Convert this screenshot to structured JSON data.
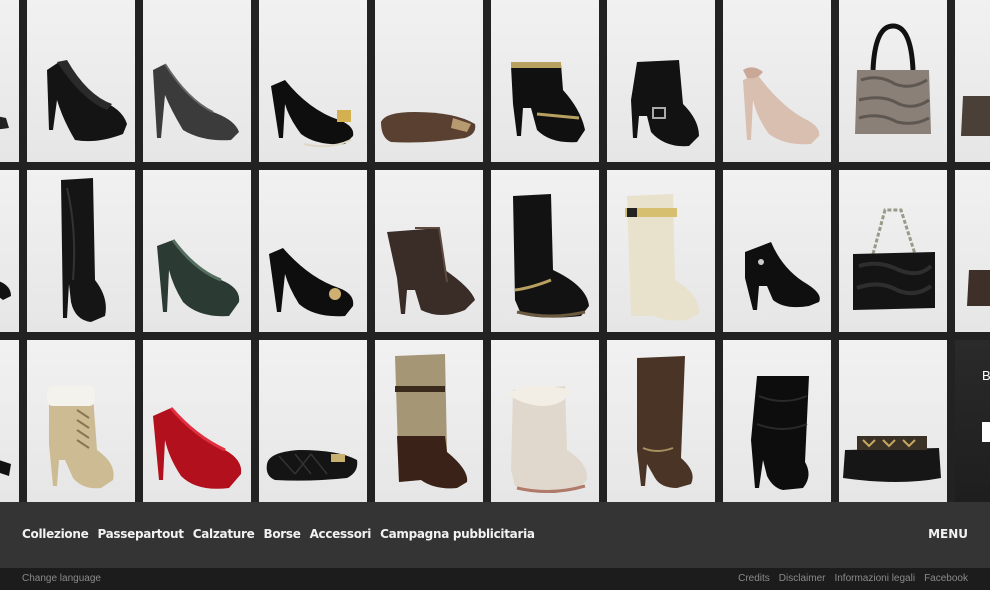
{
  "nav": {
    "items": [
      "Collezione",
      "Passepartout",
      "Calzature",
      "Borse",
      "Accessori",
      "Campagna pubblicitaria"
    ],
    "menu_label": "MENU"
  },
  "footer": {
    "change_language": "Change language",
    "links": [
      "Credits",
      "Disclaimer",
      "Informazioni legali",
      "Facebook"
    ]
  },
  "promo": {
    "partial_text": "B"
  },
  "product_grid": {
    "rows": [
      [
        "pump-icon",
        "peep-toe-pump-icon",
        "tweed-pump-icon",
        "suede-pump-icon",
        "ballet-flat-icon",
        "cutout-bootie-icon",
        "buckle-bootie-icon",
        "nude-pump-icon",
        "fur-bag-icon",
        "bag-icon"
      ],
      [
        "pump-icon",
        "thigh-boot-icon",
        "tweed-pump-icon",
        "suede-pump-icon",
        "open-bootie-icon",
        "shearling-boot-icon",
        "rain-boot-icon",
        "black-bootie-icon",
        "fur-chain-bag-icon",
        "bag-icon"
      ],
      [
        "boot-icon",
        "lace-up-bootie-icon",
        "satin-pump-icon",
        "quilted-flat-icon",
        "tall-boot-icon",
        "fur-boot-icon",
        "suede-tall-boot-icon",
        "slouch-boot-icon",
        "studded-clutch-icon",
        "promo-panel"
      ]
    ]
  },
  "colors": {
    "navbar_bg": "#343434",
    "footer_bg": "#1c1c1c",
    "grid_bg": "#222222",
    "tile_bg": "#efefef",
    "nav_text": "#f2f2f2",
    "footer_text": "#8a8a8a"
  }
}
